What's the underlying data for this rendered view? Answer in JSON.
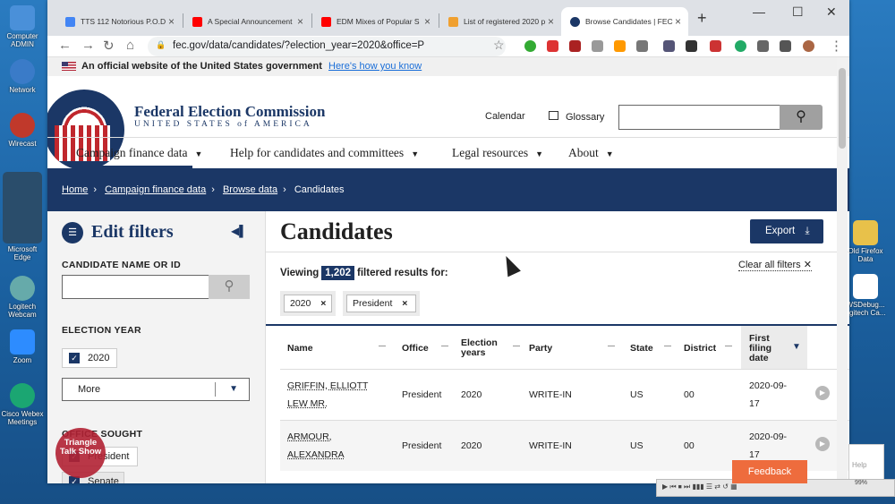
{
  "desktop": {
    "icons": [
      {
        "label": "Computer ADMIN",
        "color": "#4a90d9"
      },
      {
        "label": "Network",
        "color": "#3a7bc8"
      },
      {
        "label": "Wirecast",
        "color": "#c0392b"
      },
      {
        "label": "Microsoft Edge",
        "color": "#2a4d6b"
      },
      {
        "label": "Logitech Webcam",
        "color": "#7aa"
      },
      {
        "label": "Zoom",
        "color": "#2d8cff"
      },
      {
        "label": "Cisco Webex Meetings",
        "color": "#1ba672"
      },
      {
        "label": "Old Firefox Data",
        "color": "#e8c14a"
      },
      {
        "label": "WSDebug... ogitech Ca...",
        "color": "#ffffff"
      }
    ]
  },
  "browser": {
    "tabs": [
      {
        "title": "TTS 112 Notorious P.O.D",
        "fav": "#4285f4"
      },
      {
        "title": "A Special Announcement",
        "fav": "#ff0000"
      },
      {
        "title": "EDM Mixes of Popular S",
        "fav": "#ff0000"
      },
      {
        "title": "List of registered 2020 p",
        "fav": "#f0a030"
      },
      {
        "title": "Browse Candidates | FEC",
        "fav": "#1b3766"
      }
    ],
    "url": "fec.gov/data/candidates/?election_year=2020&office=P",
    "close_glyph": "×",
    "new_tab_glyph": "+",
    "minimize_glyph": "—",
    "maximize_glyph": "☐",
    "close_window_glyph": "✕",
    "back_glyph": "←",
    "forward_glyph": "→",
    "reload_glyph": "↻",
    "home_glyph": "⌂",
    "lock_glyph": "🔒",
    "star_glyph": "☆",
    "menu_glyph": "⋮"
  },
  "gov_banner": {
    "text": "An official website of the United States government",
    "link": "Here's how you know"
  },
  "header": {
    "logo_line1": "Federal Election Commission",
    "logo_line2": "UNITED STATES of AMERICA",
    "calendar": "Calendar",
    "glossary": "Glossary",
    "search_placeholder": "",
    "search_icon": "⚲"
  },
  "main_nav": [
    {
      "label": "Campaign finance data"
    },
    {
      "label": "Help for candidates and committees"
    },
    {
      "label": "Legal resources"
    },
    {
      "label": "About"
    }
  ],
  "caret": "▼",
  "breadcrumbs": [
    "Home",
    "Campaign finance data",
    "Browse data",
    "Candidates"
  ],
  "breadcrumb_sep": "›",
  "filters": {
    "title": "Edit filters",
    "collapse_glyph": "◀▌",
    "filter_icon": "☰",
    "candidate_label": "CANDIDATE NAME OR ID",
    "search_glyph": "⚲",
    "election_year_label": "ELECTION YEAR",
    "selected_year": "2020",
    "more_label": "More",
    "office_label": "OFFICE SOUGHT",
    "office_value": "President",
    "office_value2": "Senate"
  },
  "watermark": "Triangle Talk Show",
  "content": {
    "title": "Candidates",
    "export_label": "Export",
    "export_icon": "⤓",
    "viewing_prefix": "Viewing",
    "count": "1,202",
    "viewing_suffix": "filtered results for:",
    "clear_label": "Clear all filters",
    "clear_glyph": "✕",
    "tags": [
      "2020",
      "President"
    ],
    "tag_remove": "×"
  },
  "table": {
    "headers": [
      "Name",
      "Office",
      "Election years",
      "Party",
      "State",
      "District",
      "First filing date"
    ],
    "sort_glyph": "▼",
    "rows": [
      {
        "name": "GRIFFIN, ELLIOTT LEW MR.",
        "office": "President",
        "years": "2020",
        "party": "WRITE-IN",
        "state": "US",
        "district": "00",
        "date": "2020-09-17"
      },
      {
        "name": "ARMOUR, ALEXANDRA",
        "office": "President",
        "years": "2020",
        "party": "WRITE-IN",
        "state": "US",
        "district": "00",
        "date": "2020-09-17"
      }
    ],
    "play_glyph": "▶"
  },
  "feedback": "Feedback",
  "taskbar_text": "▶ ⏮ ⏹ ⏭ ▮▮▮ ☰ ⇄ ↺ ▦",
  "volume": "99%",
  "notif_text": "Help"
}
